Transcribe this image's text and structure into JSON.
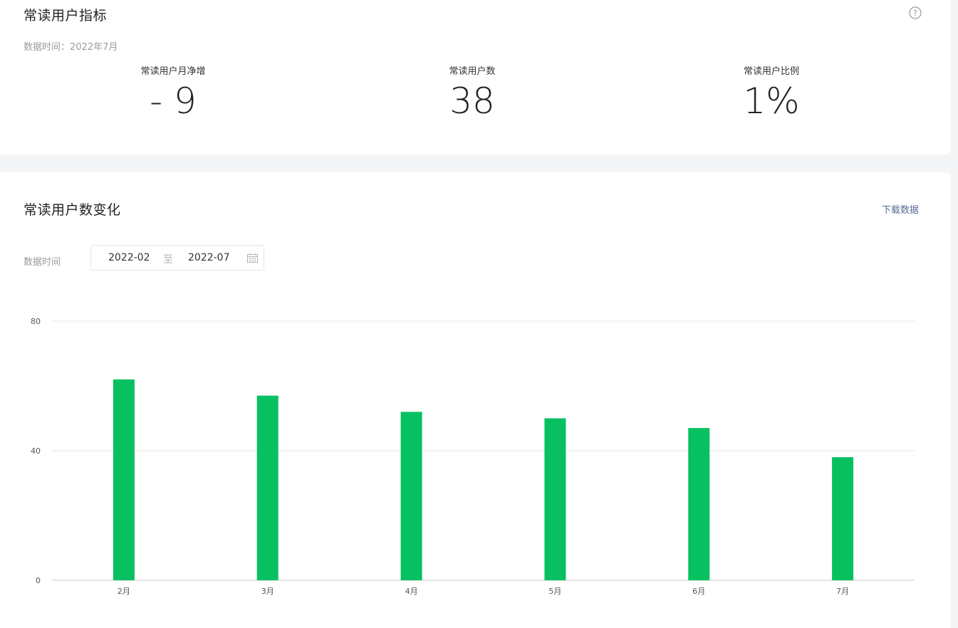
{
  "metrics_card": {
    "title": "常读用户指标",
    "data_time": "数据时间：2022年7月",
    "help_icon": "help-circle-icon",
    "metrics": [
      {
        "label": "常读用户月净增",
        "value": "- 9"
      },
      {
        "label": "常读用户数",
        "value": "38"
      },
      {
        "label": "常读用户比例",
        "value": "1%"
      }
    ]
  },
  "trend_card": {
    "title": "常读用户数变化",
    "download_label": "下载数据",
    "range_label": "数据时间",
    "date_start": "2022-02",
    "date_separator": "至",
    "date_end": "2022-07",
    "calendar_icon": "calendar-icon"
  },
  "colors": {
    "bar": "#07c160",
    "grid": "#e6e6e6",
    "link": "#576b95"
  },
  "chart_data": {
    "type": "bar",
    "categories": [
      "2月",
      "3月",
      "4月",
      "5月",
      "6月",
      "7月"
    ],
    "values": [
      62,
      57,
      52,
      50,
      47,
      38
    ],
    "ylim": [
      0,
      80
    ],
    "yticks": [
      0,
      40,
      80
    ],
    "grid": true,
    "xlabel": "",
    "ylabel": ""
  }
}
